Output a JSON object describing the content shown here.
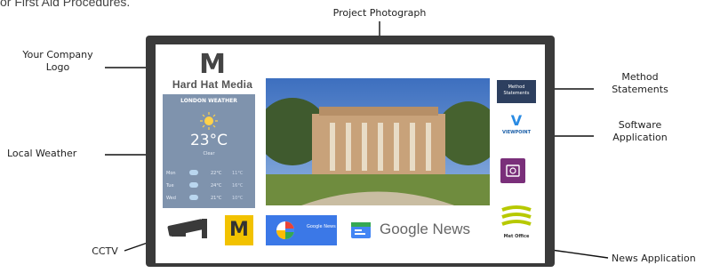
{
  "page": {
    "cut_heading": "or First Aid Procedures."
  },
  "annotations": {
    "project_photograph": "Project Photograph",
    "company_logo": "Your Company Logo",
    "method_statements": "Method Statements",
    "software_application": "Software Application",
    "local_weather": "Local Weather",
    "cctv": "CCTV",
    "news_application": "News Application"
  },
  "screen": {
    "logo": {
      "mark": "M",
      "name": "Hard Hat Media"
    },
    "weather": {
      "title": "LONDON WEATHER",
      "temperature": "23°C",
      "condition": "Clear",
      "forecast": [
        {
          "day": "Mon",
          "high": "22°C",
          "low": "11°C"
        },
        {
          "day": "Tue",
          "high": "24°C",
          "low": "16°C"
        },
        {
          "day": "Wed",
          "high": "21°C",
          "low": "10°C"
        }
      ]
    },
    "method_tile": {
      "label": "Method Statements"
    },
    "viewpoint_tile": {
      "mark": "V",
      "label": "VIEWPOINT"
    },
    "metoffice_tile": {
      "label": "Met Office"
    },
    "hh_tile": {
      "mark": "M"
    },
    "gnews_small": {
      "label": "Google News"
    },
    "gnews_big": {
      "label": "Google News"
    }
  },
  "colors": {
    "weather_bg": "#7f93ad",
    "hard_hat_yellow": "#f2c200",
    "google_blue": "#3b78e7",
    "purple_app": "#7a2f7a",
    "method_navy": "#2d3f5f"
  },
  "icons": {
    "sun": "sun-icon",
    "cloud": "cloud-icon",
    "cctv": "cctv-camera-icon",
    "google_news": "google-news-icon",
    "purple_app": "app-document-icon",
    "met_office": "met-office-logo"
  }
}
